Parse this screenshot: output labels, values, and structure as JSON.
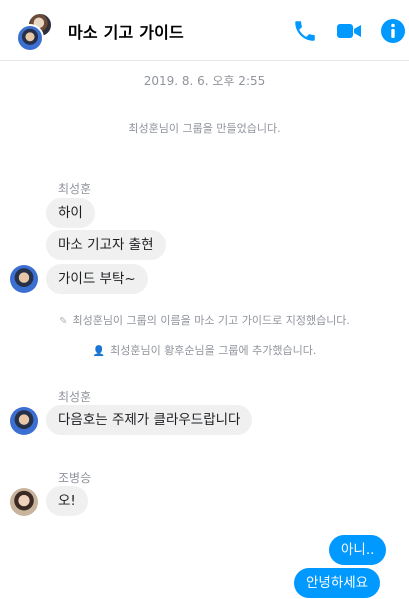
{
  "header": {
    "title": "마소 기고 가이드",
    "icons": [
      "phone-icon",
      "video-icon",
      "info-icon"
    ],
    "accent": "#0099ff"
  },
  "timestamp": "2019. 8. 6. 오후 2:55",
  "system": {
    "created": "최성훈님이 그룹을 만들었습니다.",
    "renamed": "최성훈님이 그룹의 이름을 마소 기고 가이드로 지정했습니다.",
    "added": "최성훈님이 황후순님을 그룹에 추가했습니다."
  },
  "messages": {
    "sender1": "최성훈",
    "m1": "하이",
    "m2": "마소 기고자 출현",
    "m3": "가이드 부탁~",
    "sender2": "최성훈",
    "m4": "다음호는 주제가 클라우드랍니다",
    "sender3": "조병승",
    "m5": "오!",
    "out1": "아니..",
    "out2": "안녕하세요"
  }
}
